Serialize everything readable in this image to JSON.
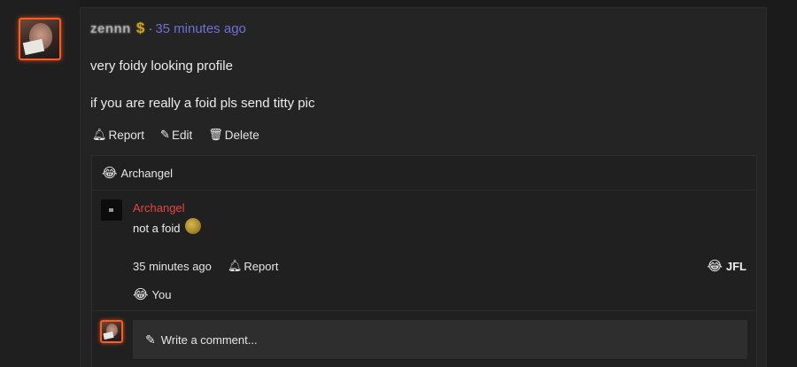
{
  "post": {
    "username": "zennn",
    "username_icon": "money-bag-icon",
    "separator": "·",
    "timestamp": "35 minutes ago",
    "lines": [
      "very foidy looking profile",
      "if you are really a foid pls send titty pic"
    ],
    "actions": {
      "report": "Report",
      "edit": "Edit",
      "delete": "Delete"
    }
  },
  "reaction": {
    "emoji": "😂",
    "user": "Archangel"
  },
  "reply": {
    "author": "Archangel",
    "author_color": "#e84545",
    "text": "not a foid",
    "text_icon": "coin-icon",
    "timestamp": "35 minutes ago",
    "report": "Report",
    "reaction_emoji": "😂",
    "reaction_label": "JFL",
    "you_emoji": "😂",
    "you_label": "You"
  },
  "composer": {
    "placeholder": "Write a comment..."
  },
  "colors": {
    "accent_orange": "#ff5a1f",
    "timestamp_blue": "#6f6fd8"
  }
}
